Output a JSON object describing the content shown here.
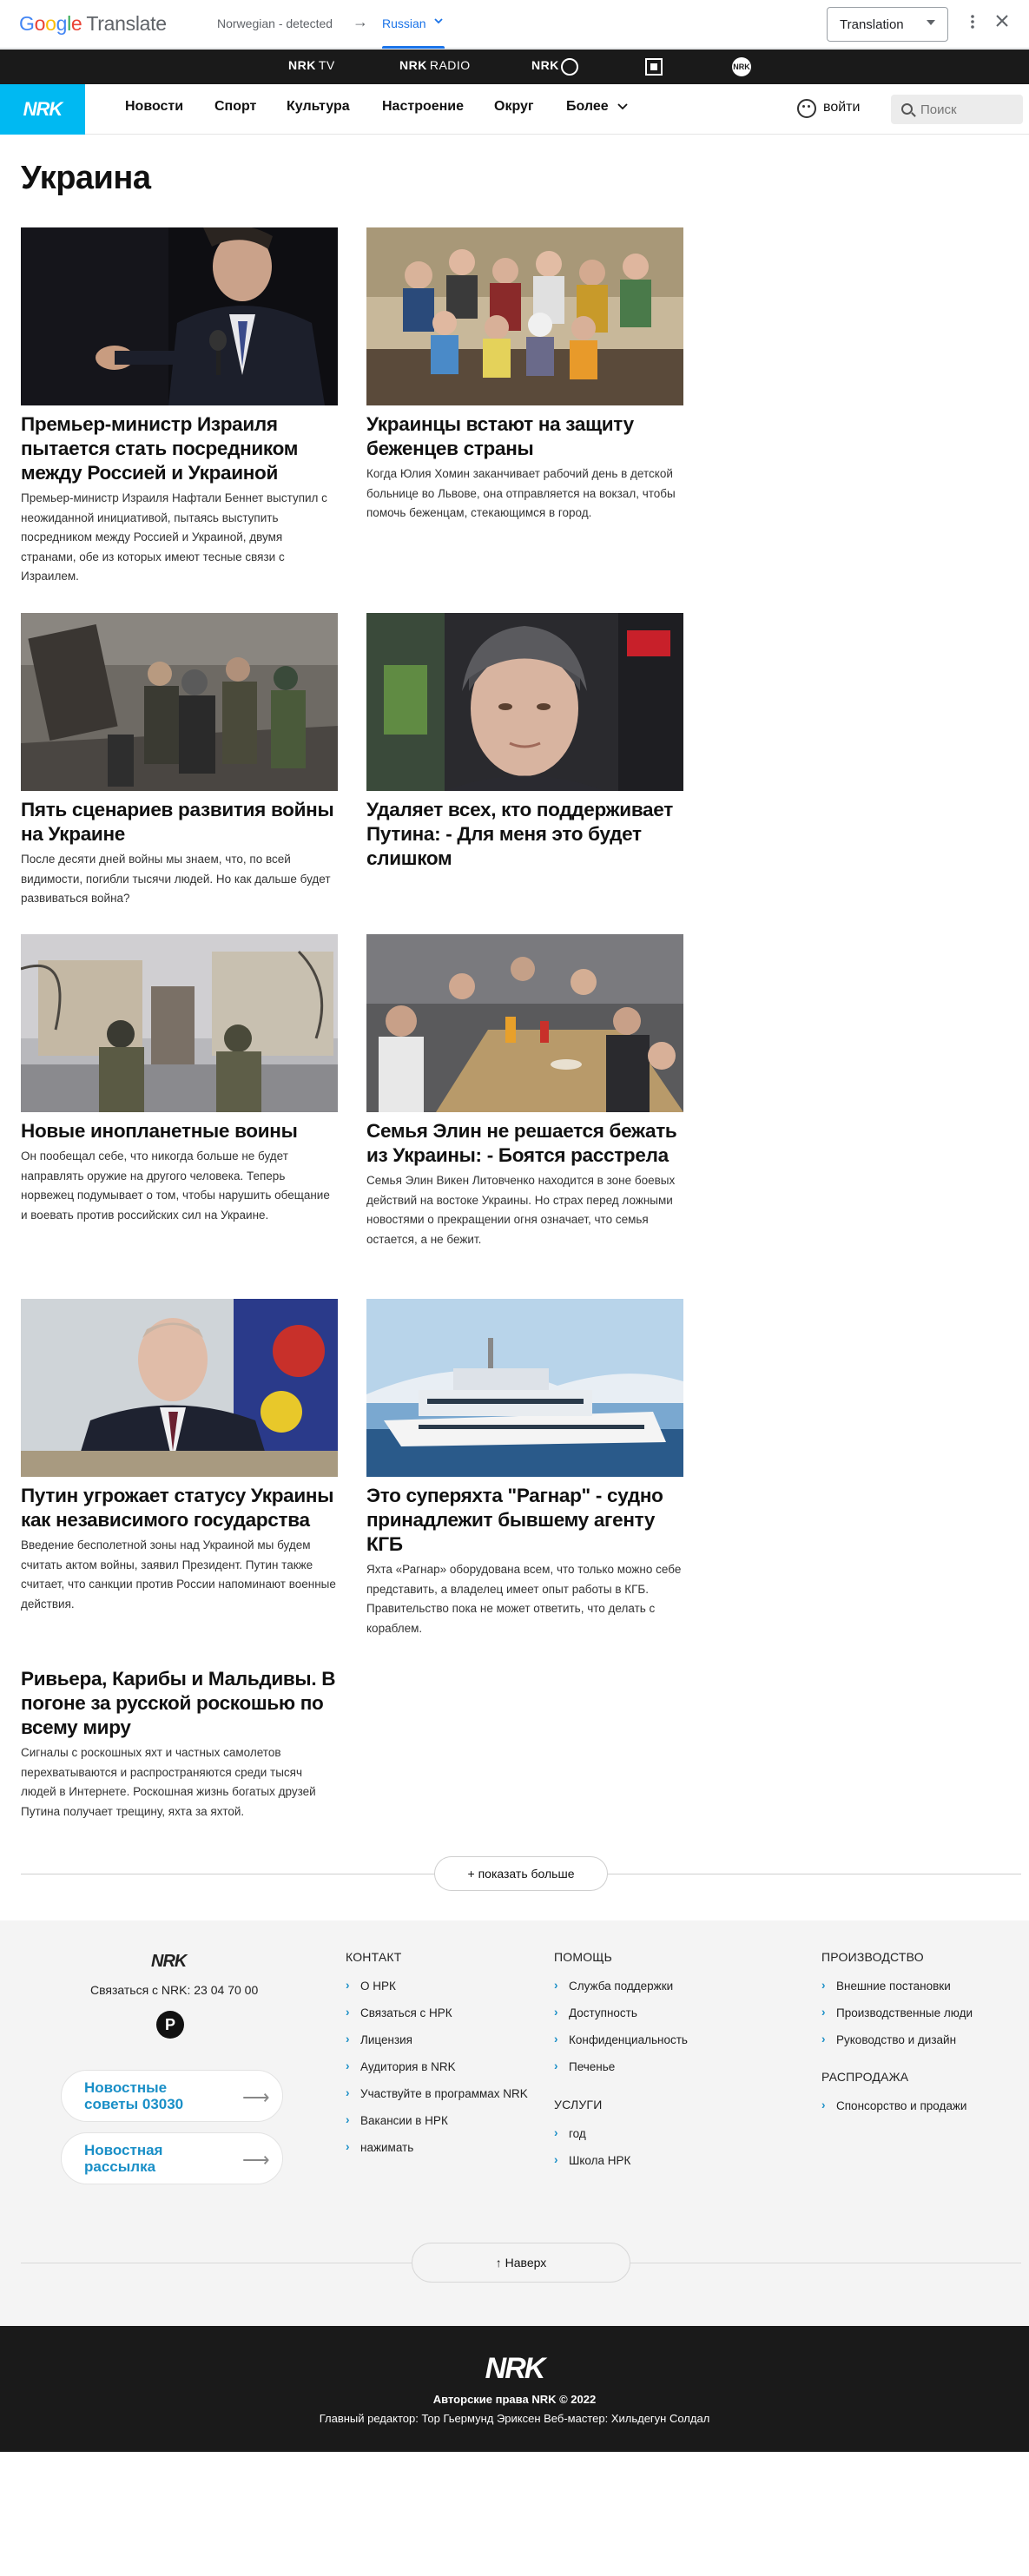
{
  "translate_bar": {
    "logo_letters": [
      "G",
      "o",
      "o",
      "g",
      "l",
      "e"
    ],
    "logo_suffix": "Translate",
    "source_lang": "Norwegian - detected",
    "arrow": "→",
    "target_lang": "Russian",
    "mode": "Translation",
    "icons": [
      "chevron-down-icon",
      "more-vert-icon",
      "close-icon"
    ],
    "colors": {
      "blue": "#4285f4",
      "red": "#ea4335",
      "yellow": "#fbbc05",
      "green": "#34a853",
      "accent": "#1a73e8"
    }
  },
  "service_bar": {
    "tv": {
      "brand": "NRK",
      "label": "TV"
    },
    "radio": {
      "brand": "NRK",
      "label": "RADIO"
    },
    "super": "NRK",
    "yr_label": "",
    "ung_label": "NRK"
  },
  "nav": {
    "logo": "NRK",
    "items": [
      "Новости",
      "Спорт",
      "Культура",
      "Настроение",
      "Округ",
      "Более"
    ],
    "login": "войти",
    "search_placeholder": "Поиск",
    "accent": "#00b9f2"
  },
  "main": {
    "title": "Украина",
    "articles": [
      {
        "title": "Премьер-министр Израиля пытается стать посредником между Россией и Украиной",
        "summary": "Премьер-министр Израиля Нафтали Беннет выступил с неожиданной инициативой, пытаясь выступить посредником между Россией и Украиной, двумя странами, обе из которых имеют тесные связи с Израилем."
      },
      {
        "title": "Украинцы встают на защиту беженцев страны",
        "summary": "Когда Юлия Хомин заканчивает рабочий день в детской больнице во Львове, она отправляется на вокзал, чтобы помочь беженцам, стекающимся в город."
      },
      {
        "title": "Пять сценариев развития войны на Украине",
        "summary": "После десяти дней войны мы знаем, что, по всей видимости, погибли тысячи людей. Но как дальше будет развиваться война?"
      },
      {
        "title": "Удаляет всех, кто поддерживает Путина: - Для меня это будет слишком",
        "summary": ""
      },
      {
        "title": "Новые инопланетные воины",
        "summary": "Он пообещал себе, что никогда больше не будет направлять оружие на другого человека. Теперь норвежец подумывает о том, чтобы нарушить обещание и воевать против российских сил на Украине."
      },
      {
        "title": "Семья Элин не решается бежать из Украины: - Боятся расстрела",
        "summary": "Семья Элин Викен Литовченко находится в зоне боевых действий на востоке Украины. Но страх перед ложными новостями о прекращении огня означает, что семья остается, а не бежит."
      },
      {
        "title": "Путин угрожает статусу Украины как независимого государства",
        "summary": "Введение бесполетной зоны над Украиной мы будем считать актом войны, заявил Президент. Путин также считает, что санкции против России напоминают военные действия."
      },
      {
        "title": "Это суперяхта \"Рагнар\" - судно принадлежит бывшему агенту КГБ",
        "summary": "Яхта «Рагнар» оборудована всем, что только можно себе представить, а владелец имеет опыт работы в КГБ. Правительство пока не может ответить, что делать с кораблем."
      },
      {
        "title": "Ривьера, Карибы и Мальдивы. В погоне за русской роскошью по всему миру",
        "summary": "Сигналы с роскошных яхт и частных самолетов перехватываются и распространяются среди тысяч людей в Интернете. Роскошная жизнь богатых друзей Путина получает трещину, яхта за яхтой."
      }
    ],
    "show_more": "+ показать больше"
  },
  "footer": {
    "logo": "NRK",
    "contact_line": "Связаться с NRK: 23 04 70 00",
    "p_icon": "P",
    "pill_tips": "Новостные советы 03030",
    "pill_newsletter": "Новостная рассылка",
    "pill_arrow": "⟶",
    "chev": "›",
    "contact": {
      "heading": "КОНТАКТ",
      "links": [
        "О НРК",
        "Связаться с НРК",
        "Лицензия",
        "Аудитория в NRK",
        "Участвуйте в программах NRK",
        "Вакансии в НРК",
        "нажимать"
      ]
    },
    "help": {
      "heading": "ПОМОЩЬ",
      "links": [
        "Служба поддержки",
        "Доступность",
        "Конфиденциальность",
        "Печенье"
      ]
    },
    "services": {
      "heading": "УСЛУГИ",
      "links": [
        "год",
        "Школа НРК"
      ]
    },
    "production": {
      "heading": "ПРОИЗВОДСТВО",
      "links": [
        "Внешние постановки",
        "Производственные люди",
        "Руководство и дизайн"
      ]
    },
    "sales": {
      "heading": "РАСПРОДАЖА",
      "links": [
        "Спонсорство и продажи"
      ]
    },
    "to_top": "↑ Наверх"
  },
  "bottom": {
    "logo": "NRK",
    "copyright": "Авторские права NRK © 2022",
    "staff": "Главный редактор: Тор Гьермунд Эриксен   Веб-мастер: Хильдегун Солдал"
  }
}
